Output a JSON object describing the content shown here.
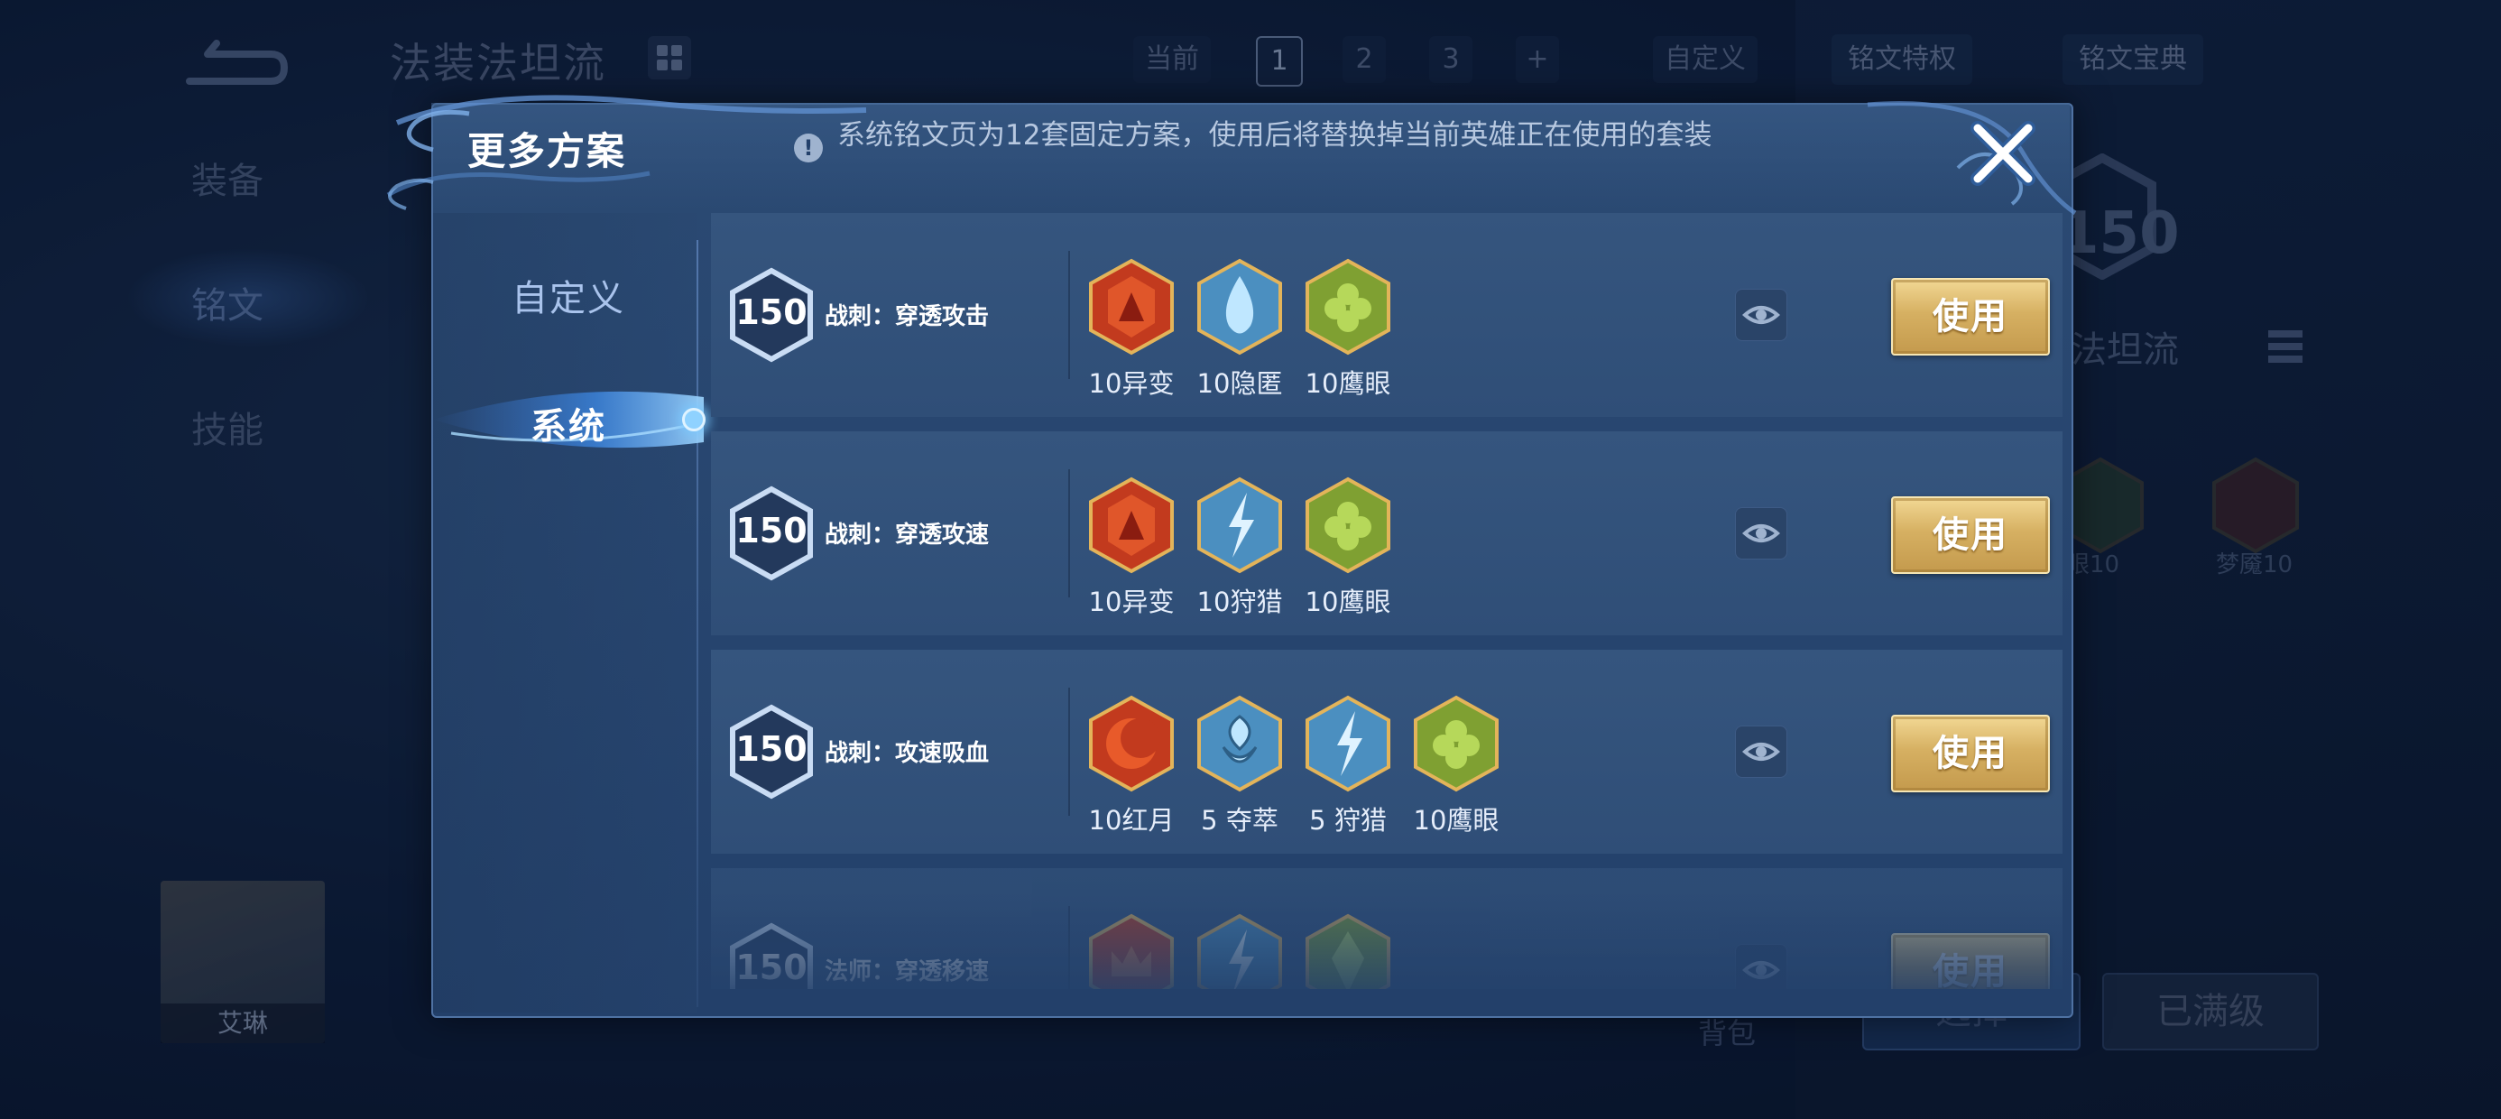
{
  "background": {
    "hero_build_title": "法装法坦流",
    "scheme_tabs": {
      "current_label": "当前",
      "numbers": [
        "1",
        "2",
        "3"
      ],
      "add": "+"
    },
    "custom_button": "自定义",
    "rune_privilege": "铭文特权",
    "rune_guide": "铭文宝典",
    "side_nav": [
      "装备",
      "铭文",
      "技能"
    ],
    "hero_name": "艾琳",
    "level_badge": "150",
    "right_title": "法坦流",
    "runes": [
      {
        "label": "眼10"
      },
      {
        "label": "梦魇10"
      }
    ],
    "backpack": "背包",
    "select_button": "选择",
    "max_level_button": "已满级"
  },
  "modal": {
    "title": "更多方案",
    "info_text": "系统铭文页为12套固定方案，使用后将替换掉当前英雄正在使用的套装",
    "tabs": [
      {
        "label": "自定义",
        "active": false
      },
      {
        "label": "系统",
        "active": true
      }
    ],
    "schemes": [
      {
        "level": "150",
        "name": "战刺：穿透攻击",
        "runes": [
          {
            "label": "10异变",
            "icon": "red-shield-rune-icon",
            "color": "#c23a1e"
          },
          {
            "label": "10隐匿",
            "icon": "blue-drop-rune-icon",
            "color": "#5fb3dd"
          },
          {
            "label": "10鹰眼",
            "icon": "green-clover-rune-icon",
            "color": "#7fa032"
          }
        ],
        "use_label": "使用"
      },
      {
        "level": "150",
        "name": "战刺：穿透攻速",
        "runes": [
          {
            "label": "10异变",
            "icon": "red-shield-rune-icon",
            "color": "#c23a1e"
          },
          {
            "label": "10狩猎",
            "icon": "blue-lightning-rune-icon",
            "color": "#5fb3dd"
          },
          {
            "label": "10鹰眼",
            "icon": "green-clover-rune-icon",
            "color": "#7fa032"
          }
        ],
        "use_label": "使用"
      },
      {
        "level": "150",
        "name": "战刺：攻速吸血",
        "runes": [
          {
            "label": "10红月",
            "icon": "red-moon-rune-icon",
            "color": "#c23a1e"
          },
          {
            "label": "5 夺萃",
            "icon": "blue-knot-rune-icon",
            "color": "#5fb3dd"
          },
          {
            "label": "5 狩猎",
            "icon": "blue-lightning-rune-icon",
            "color": "#5fb3dd"
          },
          {
            "label": "10鹰眼",
            "icon": "green-clover-rune-icon",
            "color": "#7fa032"
          }
        ],
        "use_label": "使用"
      },
      {
        "level": "150",
        "name": "法师：穿透移速",
        "runes": [
          {
            "label": "",
            "icon": "red-crown-rune-icon",
            "color": "#c23a1e"
          },
          {
            "label": "",
            "icon": "blue-lightning-rune-icon",
            "color": "#5fb3dd"
          },
          {
            "label": "",
            "icon": "green-leaf-rune-icon",
            "color": "#7fa032"
          }
        ],
        "use_label": "使用"
      }
    ]
  }
}
